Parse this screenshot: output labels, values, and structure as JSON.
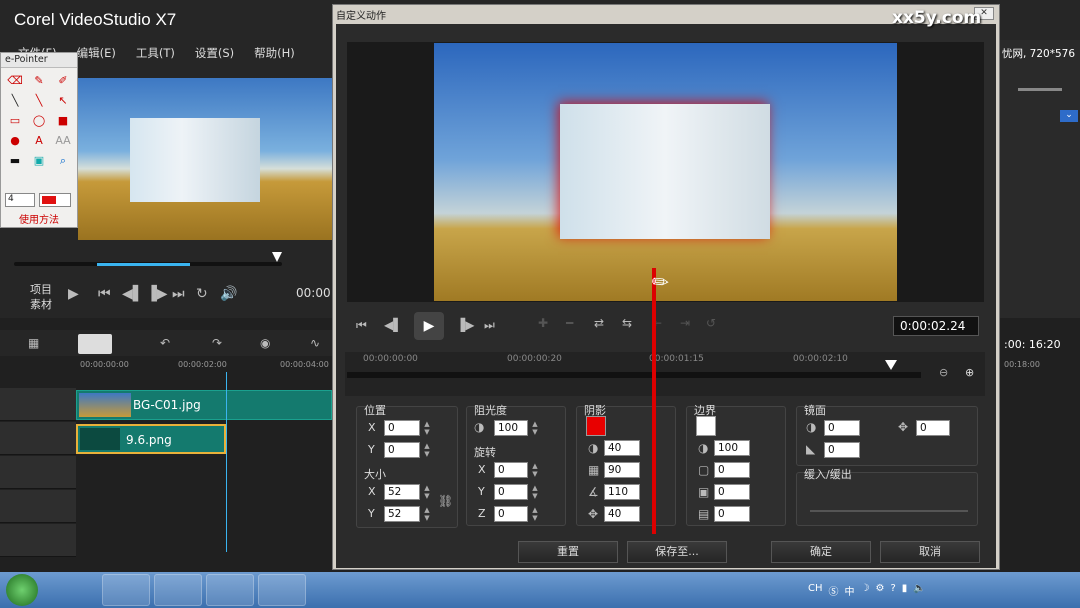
{
  "app": {
    "title": "Corel  VideoStudio X7",
    "menu": [
      "文件(F)",
      "编辑(E)",
      "工具(T)",
      "设置(S)",
      "帮助(H)"
    ],
    "info_right": "忧网, 720*576",
    "project_label": "项目",
    "clip_label": "素材",
    "timecode_left": "00:00",
    "timecode_right": ":00: 16:20",
    "right_ruler": "00:18:00"
  },
  "epointer": {
    "title": "e-Pointer",
    "size_value": "4",
    "usage_label": "使用方法",
    "accent_color": "#e01010"
  },
  "timeline": {
    "ruler": [
      "00:00:00:00",
      "00:00:02:00",
      "00:00:04:00"
    ],
    "clips": [
      {
        "name": "BG-C01.jpg"
      },
      {
        "name": "9.6.png"
      }
    ]
  },
  "dialog": {
    "title": "自定义动作",
    "timecode": "0:00:02.24",
    "ruler": [
      "00:00:00:00",
      "00:00:00:20",
      "00:00:01:15",
      "00:00:02:10"
    ],
    "position": {
      "label": "位置",
      "x": "0",
      "y": "0"
    },
    "size": {
      "label": "大小",
      "x": "52",
      "y": "52"
    },
    "opacity": {
      "label": "阻光度",
      "value": "100"
    },
    "rotation": {
      "label": "旋转",
      "x": "0",
      "y": "0",
      "z": "0"
    },
    "shadow": {
      "label": "阴影",
      "color": "#e80000",
      "v1": "40",
      "v2": "90",
      "v3": "110",
      "v4": "40"
    },
    "border": {
      "label": "边界",
      "color": "#ffffff",
      "v1": "100",
      "v2": "0",
      "v3": "0",
      "v4": "0"
    },
    "mirror": {
      "label": "镜面",
      "v1": "0",
      "v2": "0",
      "v3": "0"
    },
    "fade": {
      "label": "缓入/缓出"
    },
    "buttons": {
      "reset": "重置",
      "save": "保存至...",
      "ok": "确定",
      "cancel": "取消"
    }
  },
  "watermark": "xx5y.com",
  "taskbar": {
    "tray_lang": "CH",
    "tray_ime": "中"
  }
}
